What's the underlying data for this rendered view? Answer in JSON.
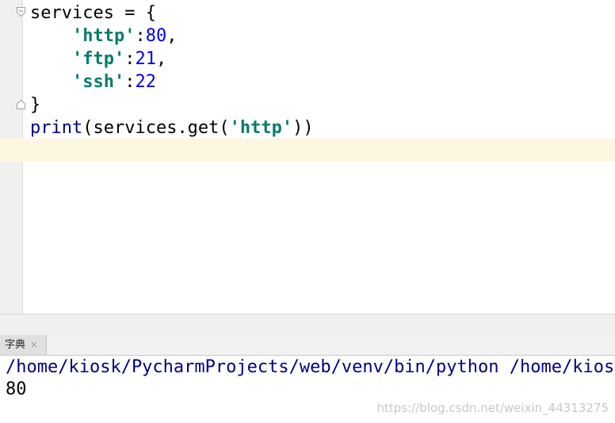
{
  "editor": {
    "lines": [
      {
        "parts": [
          {
            "t": "services = {",
            "c": "plain"
          }
        ]
      },
      {
        "parts": [
          {
            "t": "    ",
            "c": "plain"
          },
          {
            "t": "'http'",
            "c": "str"
          },
          {
            "t": ":",
            "c": "plain"
          },
          {
            "t": "80",
            "c": "num"
          },
          {
            "t": ",",
            "c": "plain"
          }
        ]
      },
      {
        "parts": [
          {
            "t": "    ",
            "c": "plain"
          },
          {
            "t": "'ftp'",
            "c": "str"
          },
          {
            "t": ":",
            "c": "plain"
          },
          {
            "t": "21",
            "c": "num"
          },
          {
            "t": ",",
            "c": "plain"
          }
        ]
      },
      {
        "parts": [
          {
            "t": "    ",
            "c": "plain"
          },
          {
            "t": "'ssh'",
            "c": "str"
          },
          {
            "t": ":",
            "c": "plain"
          },
          {
            "t": "22",
            "c": "num"
          }
        ]
      },
      {
        "parts": [
          {
            "t": "}",
            "c": "plain"
          }
        ]
      },
      {
        "parts": [
          {
            "t": "print",
            "c": "builtin"
          },
          {
            "t": "(services.get(",
            "c": "plain"
          },
          {
            "t": "'http'",
            "c": "str"
          },
          {
            "t": "))",
            "c": "plain"
          }
        ]
      }
    ]
  },
  "run_panel": {
    "tab_label": "字典",
    "close_glyph": "×"
  },
  "console": {
    "command_line": "/home/kiosk/PycharmProjects/web/venv/bin/python /home/kiosk/PycharmProjects/web/字典.py",
    "output": "80"
  },
  "watermark": "https://blog.csdn.net/weixin_44313275",
  "colors": {
    "string": "#067d6b",
    "number": "#0000ee",
    "builtin": "#000080",
    "caret_line": "#fdf7e1"
  }
}
